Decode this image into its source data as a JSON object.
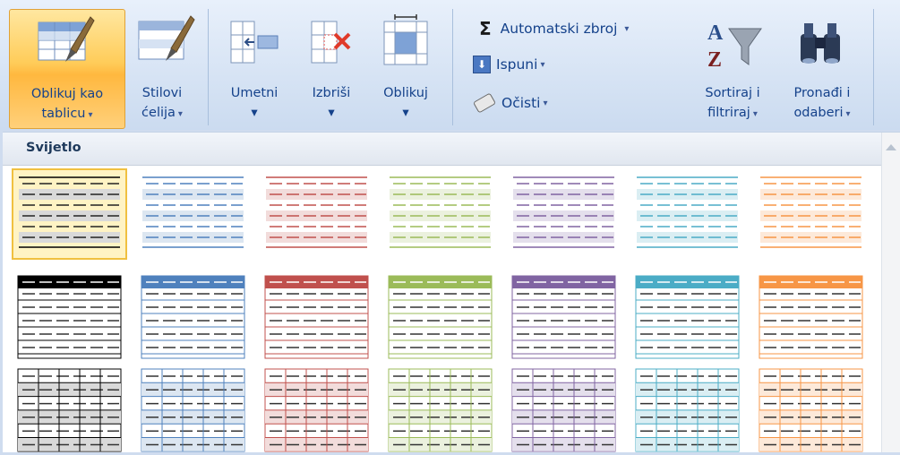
{
  "ribbon": {
    "format_as_table": {
      "line1": "Oblikuj kao",
      "line2": "tablicu",
      "dropdown": "▾"
    },
    "cell_styles": {
      "line1": "Stilovi",
      "line2": "ćelija",
      "dropdown": "▾"
    },
    "insert": {
      "label": "Umetni",
      "dropdown": "▾"
    },
    "delete": {
      "label": "Izbriši",
      "dropdown": "▾"
    },
    "format": {
      "label": "Oblikuj",
      "dropdown": "▾"
    },
    "autosum": {
      "label": "Automatski zbroj",
      "icon": "Σ",
      "dropdown": "▾"
    },
    "fill": {
      "label": "Ispuni",
      "dropdown": "▾"
    },
    "clear": {
      "label": "Očisti",
      "dropdown": "▾"
    },
    "sort_filter": {
      "line1": "Sortiraj i",
      "line2": "filtriraj",
      "dropdown": "▾"
    },
    "find_select": {
      "line1": "Pronađi i",
      "line2": "odaberi",
      "dropdown": "▾"
    }
  },
  "gallery": {
    "section_title": "Svijetlo",
    "palette": [
      "#000000",
      "#4f81bd",
      "#c0504d",
      "#9bbb59",
      "#8064a2",
      "#4bacc6",
      "#f79646"
    ],
    "tints": [
      "#d9d9d9",
      "#dce6f1",
      "#f2dcdb",
      "#ebf1de",
      "#e4dfec",
      "#daeef3",
      "#fde9d9"
    ]
  }
}
